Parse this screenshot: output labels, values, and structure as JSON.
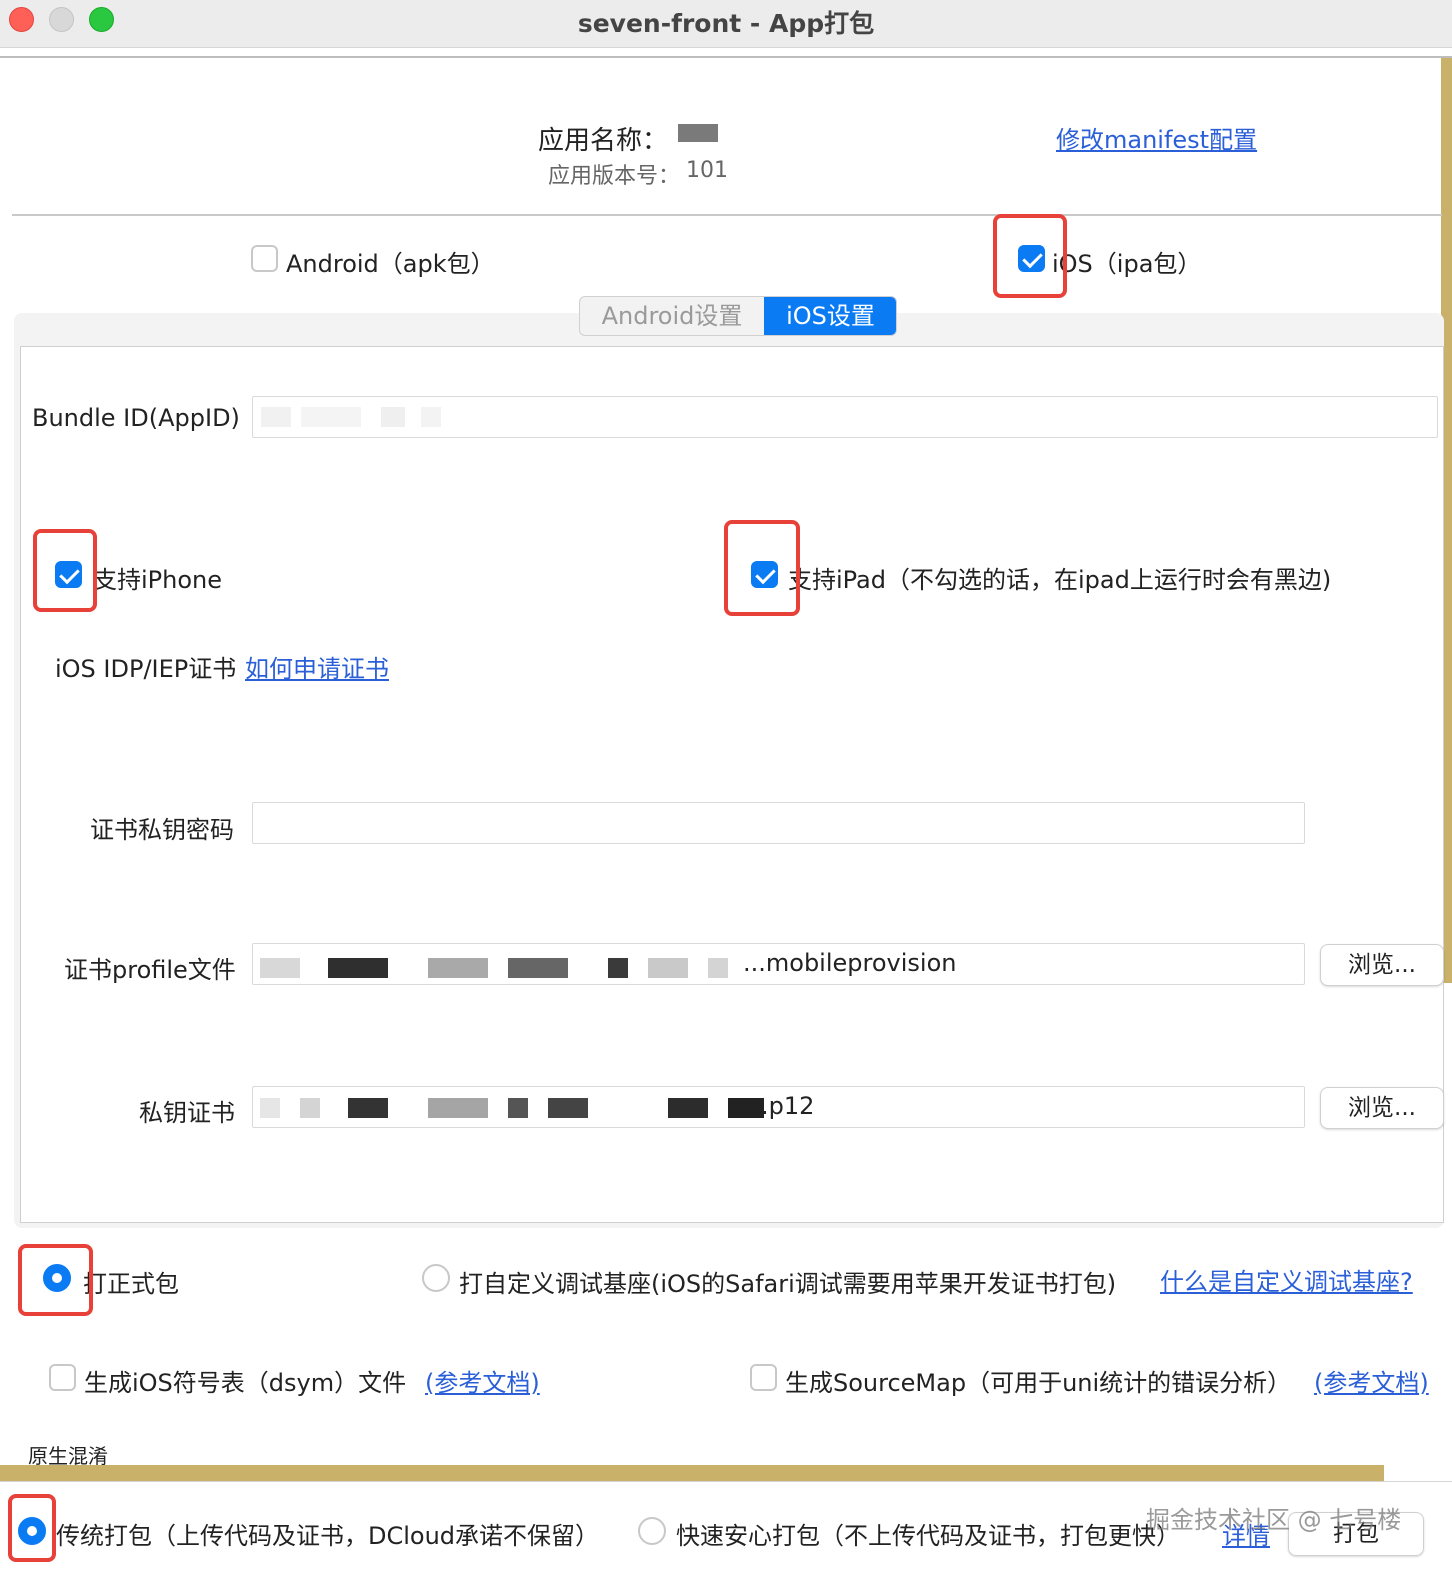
{
  "window": {
    "title": "seven-front - App打包"
  },
  "header": {
    "app_name_label": "应用名称：",
    "version_label": "应用版本号：",
    "version_value": "101",
    "manifest_link": "修改manifest配置"
  },
  "platforms": {
    "android": {
      "label": "Android（apk包）",
      "checked": false
    },
    "ios": {
      "label": "iOS（ipa包）",
      "checked": true
    }
  },
  "tabs": [
    {
      "label": "Android设置",
      "active": false
    },
    {
      "label": "iOS设置",
      "active": true
    }
  ],
  "ios_settings": {
    "bundle_id_label": "Bundle ID(AppID)",
    "bundle_id_value": "",
    "support_iphone": {
      "label": "支持iPhone",
      "checked": true
    },
    "support_ipad": {
      "label": "支持iPad（不勾选的话，在ipad上运行时会有黑边)",
      "checked": true
    },
    "cert_section_label": "iOS IDP/IEP证书",
    "cert_help_link": "如何申请证书",
    "private_key_password_label": "证书私钥密码",
    "private_key_password_value": "",
    "profile_label": "证书profile文件",
    "profile_value_suffix": "...mobileprovision",
    "private_key_cert_label": "私钥证书",
    "private_key_cert_suffix": ".p12",
    "browse_label": "浏览..."
  },
  "build_type": {
    "formal": {
      "label": "打正式包",
      "selected": true
    },
    "custom_base": {
      "label": "打自定义调试基座(iOS的Safari调试需要用苹果开发证书打包)",
      "selected": false
    },
    "custom_base_link": "什么是自定义调试基座?"
  },
  "extras": {
    "dsym": {
      "label": "生成iOS符号表（dsym）文件",
      "checked": false
    },
    "dsym_link": "(参考文档)",
    "sourcemap": {
      "label": "生成SourceMap（可用于uni统计的错误分析）",
      "checked": false
    },
    "sourcemap_link": "(参考文档)"
  },
  "obfuscation": {
    "label": "原生混淆"
  },
  "pack_mode": {
    "traditional": {
      "label": "传统打包（上传代码及证书，DCloud承诺不保留）",
      "selected": true
    },
    "fast": {
      "label": "快速安心打包（不上传代码及证书，打包更快）",
      "selected": false
    },
    "details_link": "详情",
    "pack_button": "打包"
  },
  "watermark": "掘金技术社区 @ 七号楼",
  "colors": {
    "accent": "#0b7bf4",
    "highlight_box": "#e8413a",
    "link": "#2a5fd8"
  }
}
